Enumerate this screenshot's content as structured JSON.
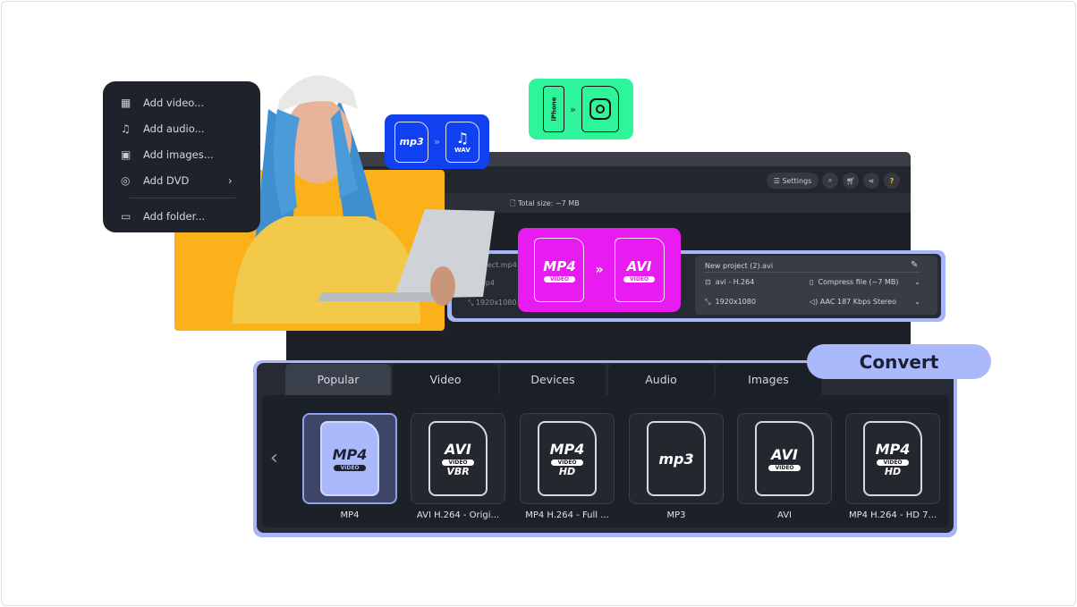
{
  "menu": {
    "items": [
      {
        "label": "Add video...",
        "icon": "video-add-icon",
        "glyph": "▦"
      },
      {
        "label": "Add audio...",
        "icon": "music-note-icon",
        "glyph": "♫"
      },
      {
        "label": "Add images...",
        "icon": "image-add-icon",
        "glyph": "▣"
      },
      {
        "label": "Add DVD",
        "icon": "dvd-icon",
        "glyph": "◎",
        "submenu": "›"
      },
      {
        "label": "Add folder...",
        "icon": "folder-add-icon",
        "glyph": "▭"
      }
    ]
  },
  "badges": {
    "audio": {
      "from": "mp3",
      "to": "WAV",
      "arrow": "»",
      "color": "#1040f0"
    },
    "device": {
      "from": "iPhone",
      "arrow": "»",
      "to_icon": "instagram-icon",
      "color": "#2ef59a"
    },
    "video": {
      "from": "MP4",
      "from_sub": "VIDEO",
      "to": "AVI",
      "to_sub": "VIDEO",
      "arrow": "»",
      "color": "#e81cf0"
    }
  },
  "toolbar": {
    "settings": "Settings",
    "settings_icon": "sliders-icon",
    "search_icon": "search-icon",
    "cart_icon": "cart-icon",
    "share_icon": "share-icon",
    "help": "?"
  },
  "info": {
    "total_size": "Total size: ~7 MB"
  },
  "input_file": {
    "name": "...ject.mp4",
    "format": "mp4",
    "resolution": "1920x1080"
  },
  "output": {
    "name": "New project (2).avi",
    "format": "avi - H.264",
    "size_option": "Compress file (~7 MB)",
    "resolution": "1920x1080",
    "audio": "AAC 187 Kbps Stereo"
  },
  "tabs": [
    "Popular",
    "Video",
    "Devices",
    "Audio",
    "Images"
  ],
  "active_tab": "Popular",
  "convert_label": "Convert",
  "formats": [
    {
      "label": "MP4",
      "logo": "MP4",
      "pill": "VIDEO",
      "sub": "",
      "selected": true
    },
    {
      "label": "AVI H.264 - Origi...",
      "logo": "AVI",
      "pill": "VIDEO",
      "sub": "VBR"
    },
    {
      "label": "MP4 H.264 - Full ...",
      "logo": "MP4",
      "pill": "VIDEO",
      "sub": "HD"
    },
    {
      "label": "MP3",
      "logo": "mp3",
      "pill": "",
      "sub": ""
    },
    {
      "label": "AVI",
      "logo": "AVI",
      "pill": "VIDEO",
      "sub": ""
    },
    {
      "label": "MP4 H.264 - HD 7...",
      "logo": "MP4",
      "pill": "VIDEO",
      "sub": "HD"
    }
  ],
  "colors": {
    "accent": "#aab9fb",
    "yellow": "#fbb21a",
    "dark": "#1d2127"
  }
}
